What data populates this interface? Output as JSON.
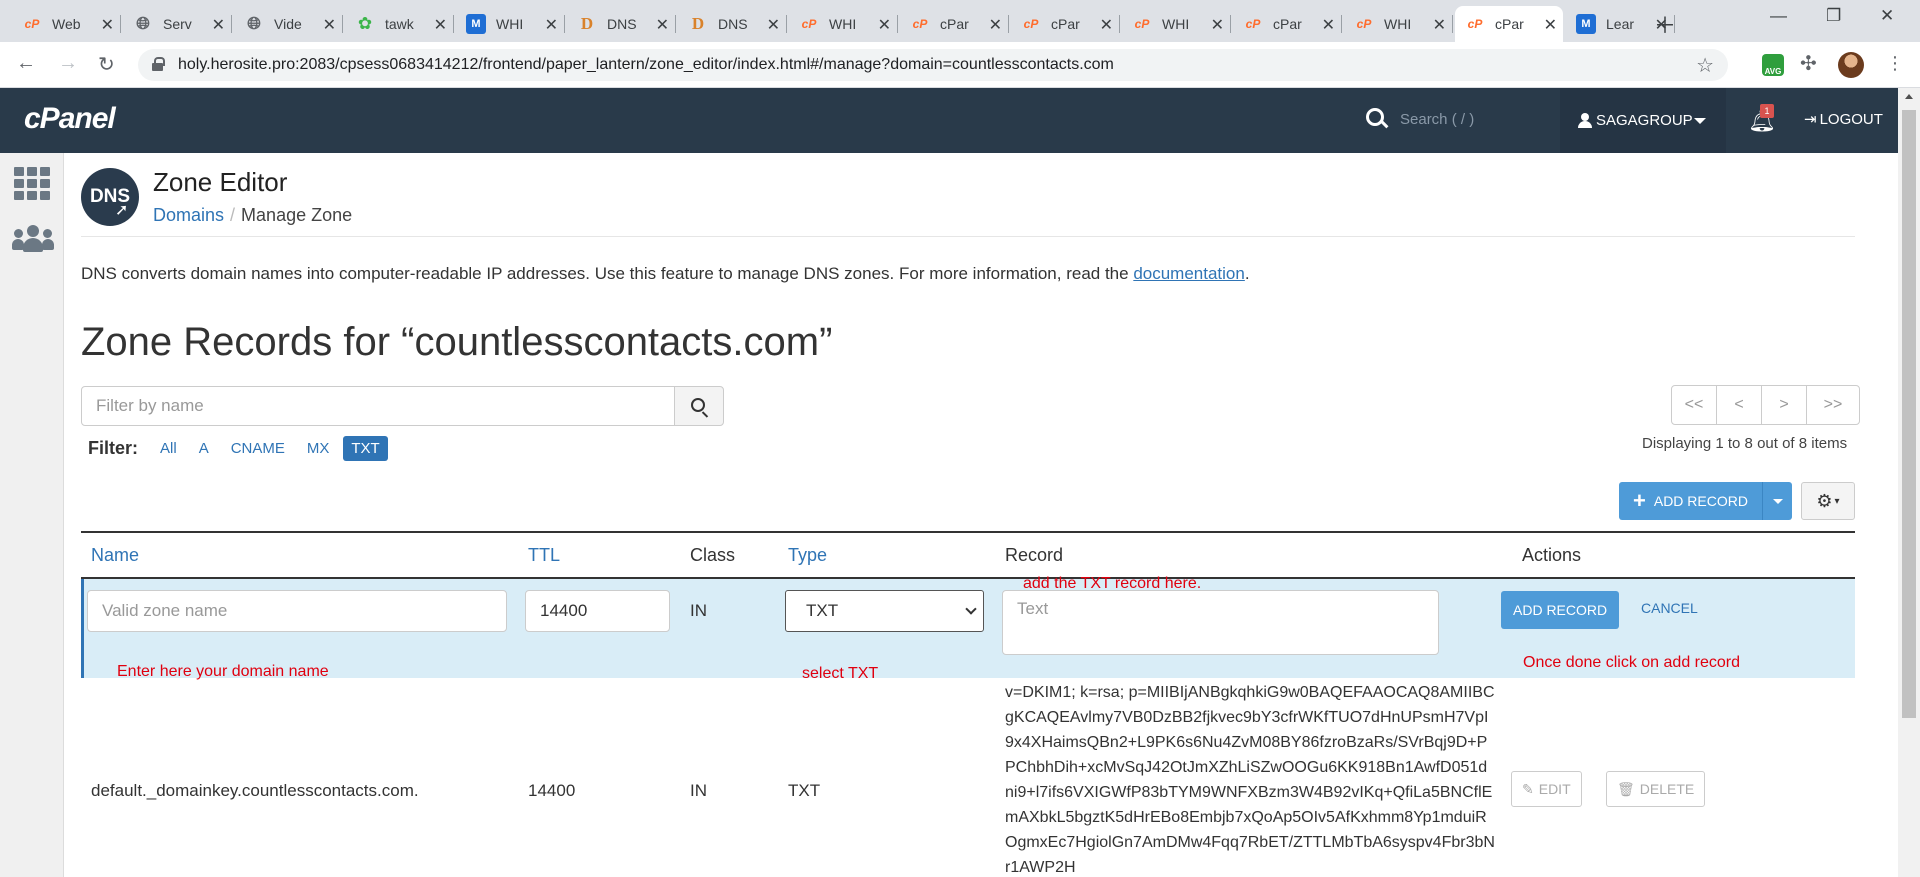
{
  "browser": {
    "tabs": [
      {
        "title": "Web",
        "icon": "cpanel-favicon"
      },
      {
        "title": "Serv",
        "icon": "globe-icon"
      },
      {
        "title": "Vide",
        "icon": "globe-icon"
      },
      {
        "title": "tawk",
        "icon": "tawk-favicon"
      },
      {
        "title": "WHI",
        "icon": "m-favicon"
      },
      {
        "title": "DNS",
        "icon": "d-favicon"
      },
      {
        "title": "DNS",
        "icon": "d-favicon"
      },
      {
        "title": "WHI",
        "icon": "cpanel-favicon"
      },
      {
        "title": "cPar",
        "icon": "cpanel-favicon"
      },
      {
        "title": "cPar",
        "icon": "cpanel-favicon"
      },
      {
        "title": "WHI",
        "icon": "cpanel-favicon"
      },
      {
        "title": "cPar",
        "icon": "cpanel-favicon"
      },
      {
        "title": "WHI",
        "icon": "cpanel-favicon"
      },
      {
        "title": "cPar",
        "icon": "cpanel-favicon",
        "active": true
      },
      {
        "title": "Lear",
        "icon": "m-favicon"
      }
    ],
    "url": "holy.herosite.pro:2083/cpsess0683414212/frontend/paper_lantern/zone_editor/index.html#/manage?domain=countlesscontacts.com",
    "ext_avg_label": "AVG"
  },
  "header": {
    "logo": "cPanel",
    "search_placeholder": "Search ( / )",
    "user": "SAGAGROUP",
    "notification_count": "1",
    "logout": "LOGOUT"
  },
  "page": {
    "title": "Zone Editor",
    "app_icon_text": "DNS",
    "breadcrumb": {
      "root": "Domains",
      "current": "Manage Zone"
    },
    "description_before": "DNS converts domain names into computer-readable IP addresses. Use this feature to manage DNS zones. For more information, read the ",
    "description_link": "documentation",
    "description_after": ".",
    "zone_heading": "Zone Records for “countlesscontacts.com”",
    "filter_placeholder": "Filter by name",
    "pager": [
      "<<",
      "<",
      ">",
      ">>"
    ],
    "displaying": "Displaying 1 to 8 out of 8 items",
    "filter_label": "Filter:",
    "filters": [
      "All",
      "A",
      "CNAME",
      "MX",
      "TXT"
    ],
    "active_filter": "TXT",
    "add_record": "ADD RECORD"
  },
  "table": {
    "headers": {
      "name": "Name",
      "ttl": "TTL",
      "class": "Class",
      "type": "Type",
      "record": "Record",
      "actions": "Actions"
    },
    "new_row": {
      "name_placeholder": "Valid zone name",
      "ttl_value": "14400",
      "class": "IN",
      "type_selected": "TXT",
      "record_placeholder": "Text",
      "add_button": "ADD RECORD",
      "cancel_button": "CANCEL"
    },
    "rows": [
      {
        "name": "default._domainkey.countlesscontacts.com.",
        "ttl": "14400",
        "class": "IN",
        "type": "TXT",
        "record": "v=DKIM1; k=rsa; p=MIIBIjANBgkqhkiG9w0BAQEFAAOCAQ8AMIIBCgKCAQEAvlmy7VB0DzBB2fjkvec9bY3cfrWKfTUO7dHnUPsmH7VpI9x4XHaimsQBn2+L9PK6s6Nu4ZvM08BY86fzroBzaRs/SVrBqj9D+PPChbhDih+xcMvSqJ42OtJmXZhLiSZwOOGu6KK918Bn1AwfD051dni9+l7ifs6VXIGWfP83bTYM9WNFXBzm3W4B92vIKq+QfiLa5BNCflEmAXbkL5bgztK5dHrEBo8Embjb7xQoAp5OIv5AfKxhmm8Yp1mduiROgmxEc7HgiolGn7AmDMw4Fqq7RbET/ZTTLMbTbA6syspv4Fbr3bNr1AWP2H",
        "edit": "EDIT",
        "delete": "DELETE"
      }
    ]
  },
  "annotations": {
    "record_hint": "add the TXT record here.",
    "name_hint": "Enter here your domain name",
    "type_hint": "select TXT",
    "action_hint": "Once done click on add record"
  }
}
